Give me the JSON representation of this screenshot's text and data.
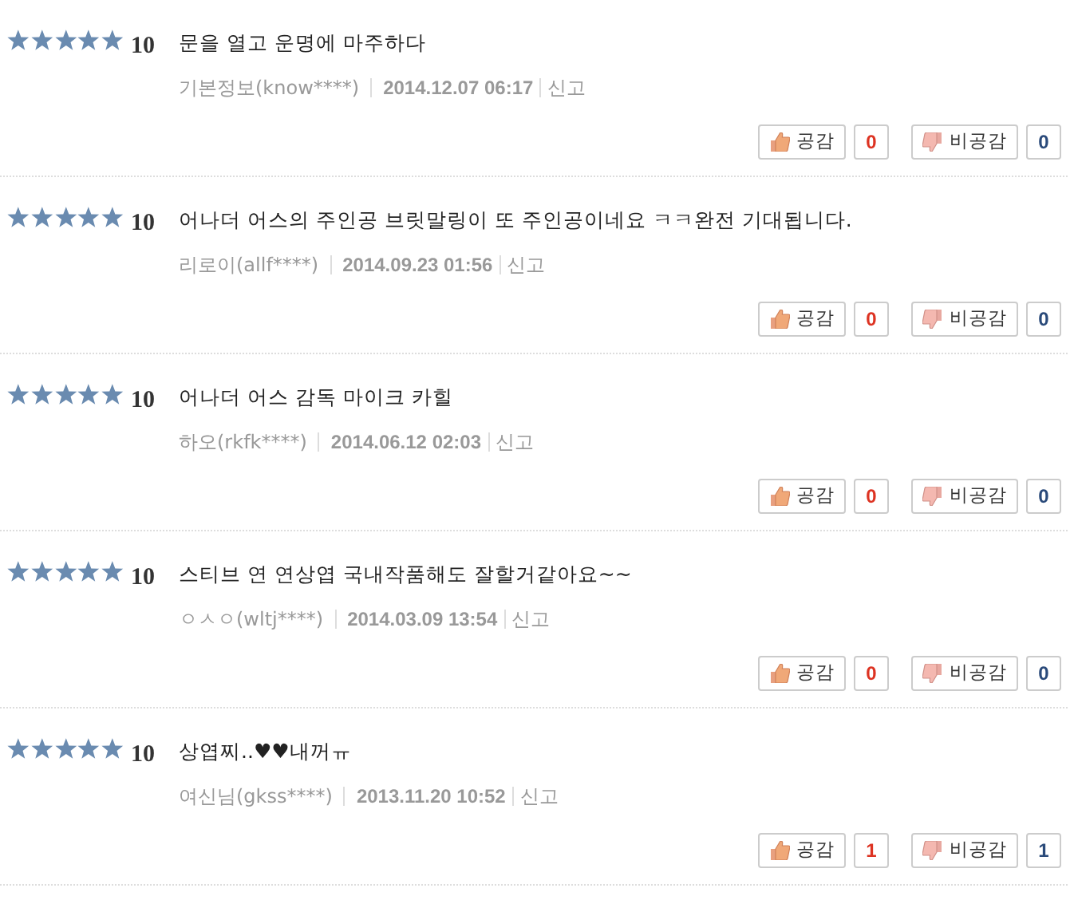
{
  "reviews": [
    {
      "stars": 5,
      "score": "10",
      "text": "문을 열고 운명에 마주하다",
      "author": "기본정보(know****)",
      "date": "2014.12.07 06:17",
      "report": "신고",
      "like_label": "공감",
      "like_count": "0",
      "dislike_label": "비공감",
      "dislike_count": "0"
    },
    {
      "stars": 5,
      "score": "10",
      "text": "어나더 어스의 주인공 브릿말링이 또 주인공이네요 ㅋㅋ완전 기대됩니다.",
      "author": "리로이(allf****)",
      "date": "2014.09.23 01:56",
      "report": "신고",
      "like_label": "공감",
      "like_count": "0",
      "dislike_label": "비공감",
      "dislike_count": "0"
    },
    {
      "stars": 5,
      "score": "10",
      "text": "어나더 어스 감독 마이크 카힐",
      "author": "하오(rkfk****)",
      "date": "2014.06.12 02:03",
      "report": "신고",
      "like_label": "공감",
      "like_count": "0",
      "dislike_label": "비공감",
      "dislike_count": "0"
    },
    {
      "stars": 5,
      "score": "10",
      "text": "스티브 연 연상엽 국내작품해도 잘할거같아요~~",
      "author": "ㅇㅅㅇ(wltj****)",
      "date": "2014.03.09 13:54",
      "report": "신고",
      "like_label": "공감",
      "like_count": "0",
      "dislike_label": "비공감",
      "dislike_count": "0"
    },
    {
      "stars": 5,
      "score": "10",
      "text": "상엽찌..♥♥내꺼ㅠ",
      "author": "여신님(gkss****)",
      "date": "2013.11.20 10:52",
      "report": "신고",
      "like_label": "공감",
      "like_count": "1",
      "dislike_label": "비공감",
      "dislike_count": "1"
    }
  ]
}
